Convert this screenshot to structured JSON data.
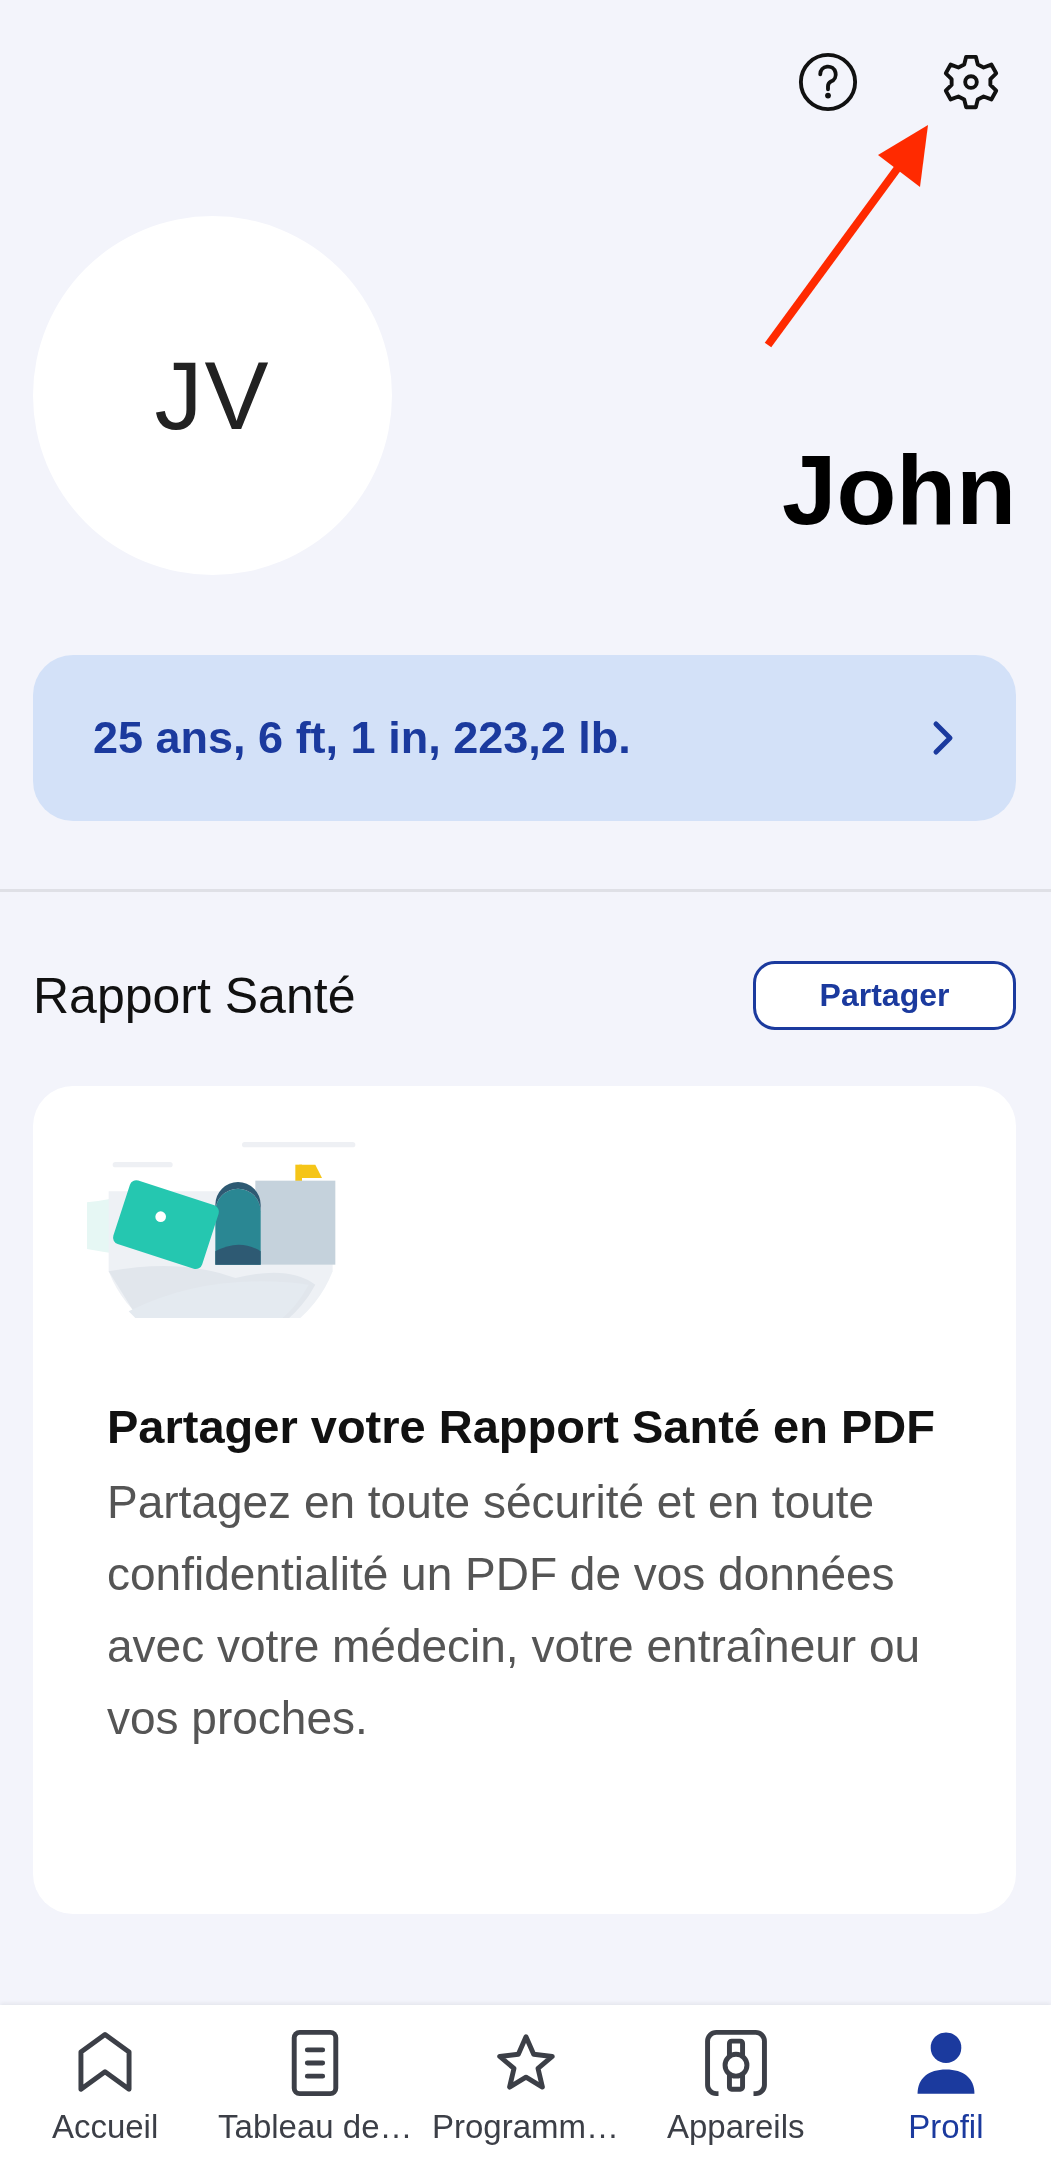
{
  "header_icons": [
    {
      "kind": "help"
    },
    {
      "kind": "settings"
    }
  ],
  "profile": {
    "initials": "JV",
    "name": "John",
    "summary": "25 ans, 6 ft, 1 in, 223,2 lb."
  },
  "health_report": {
    "title": "Rapport Santé",
    "share_button": "Partager",
    "card": {
      "title": "Partager votre Rapport Santé en PDF",
      "body": "Partagez en toute sécurité et en toute confidentialité un PDF de vos données avec votre médecin, votre entraîneur ou vos proches."
    }
  },
  "bottom_nav": [
    {
      "label": "Accueil",
      "kind": "home",
      "selected": false
    },
    {
      "label": "Tableau de…",
      "kind": "dashboard",
      "selected": false
    },
    {
      "label": "Programm…",
      "kind": "programs",
      "selected": false
    },
    {
      "label": "Appareils",
      "kind": "devices",
      "selected": false
    },
    {
      "label": "Profil",
      "kind": "profile",
      "selected": true
    }
  ]
}
